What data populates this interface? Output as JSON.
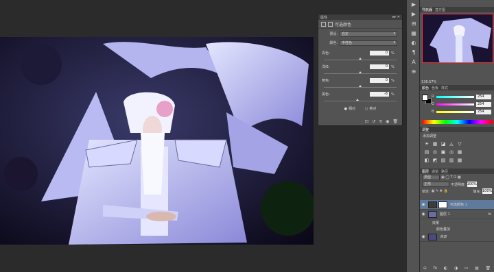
{
  "properties": {
    "panel_title": "属性",
    "header_controls": "▸▸ ✕",
    "layer_title": "可选颜色",
    "preset_label": "预设:",
    "preset_value": "自定",
    "colors_label": "颜色:",
    "colors_value": "中性色",
    "channels": [
      {
        "label": "青色:",
        "value": "0",
        "unit": "%",
        "fraction": 0.5
      },
      {
        "label": "洋红:",
        "value": "0",
        "unit": "%",
        "fraction": 0.5
      },
      {
        "label": "黄色:",
        "value": "0",
        "unit": "%",
        "fraction": 0.5
      },
      {
        "label": "黑色:",
        "value": "-8",
        "unit": "%",
        "fraction": 0.46
      }
    ],
    "method_relative": "相对",
    "method_absolute": "绝对",
    "footer_icons": [
      "⊡",
      "↺",
      "⟲",
      "◉",
      "🗑"
    ]
  },
  "strip_icons": [
    "▶",
    "▶",
    "⊞",
    "▦",
    "◐",
    "¶",
    "A",
    "⊕"
  ],
  "navigator": {
    "tabs": [
      "导航器",
      "直方图"
    ],
    "zoom": "138.67%"
  },
  "color_panel": {
    "tabs": [
      "颜色",
      "色板",
      "样式"
    ],
    "r_label": "R",
    "r_value": "254",
    "g_label": "G",
    "g_value": "254",
    "b_label": "B",
    "b_value": "254"
  },
  "adjust_panel": {
    "tab": "调整",
    "subtitle": "添加调整",
    "icons": [
      "☀",
      "▦",
      "◪",
      "◬",
      "▽",
      "",
      "",
      "",
      "▤",
      "⚖",
      "▣",
      "◎",
      "▦",
      "",
      "",
      "",
      "◧",
      "◩",
      "▨",
      "▥",
      "▦",
      "",
      "",
      ""
    ]
  },
  "layers_panel": {
    "tabs": [
      "图层",
      "通道",
      "路径"
    ],
    "kind_label": "类型",
    "filter_icons": "▣ ◯ T ⊡ ▩",
    "blend_mode": "正常",
    "opacity_label": "不透明度:",
    "opacity_value": "100%",
    "lock_label": "锁定:",
    "lock_icons": "▦ ✎ ✥ 🔒",
    "fill_label": "填充:",
    "fill_value": "100%",
    "layers": [
      {
        "name": "可选颜色 1",
        "selected": true
      },
      {
        "name": "图层 1",
        "selected": false,
        "fx": "fx"
      },
      {
        "name": "背景",
        "selected": false
      }
    ],
    "effects_label": "效果",
    "effect_item": "颜色叠加",
    "footer_icons": [
      "⊝",
      "fx",
      "◐",
      "◑",
      "▭",
      "▤",
      "🗑"
    ]
  },
  "colors": {
    "workspace_bg": "#2b2b2b",
    "panel_bg": "#535353",
    "selection": "#5f7a9a",
    "nav_border": "#ff3030"
  }
}
